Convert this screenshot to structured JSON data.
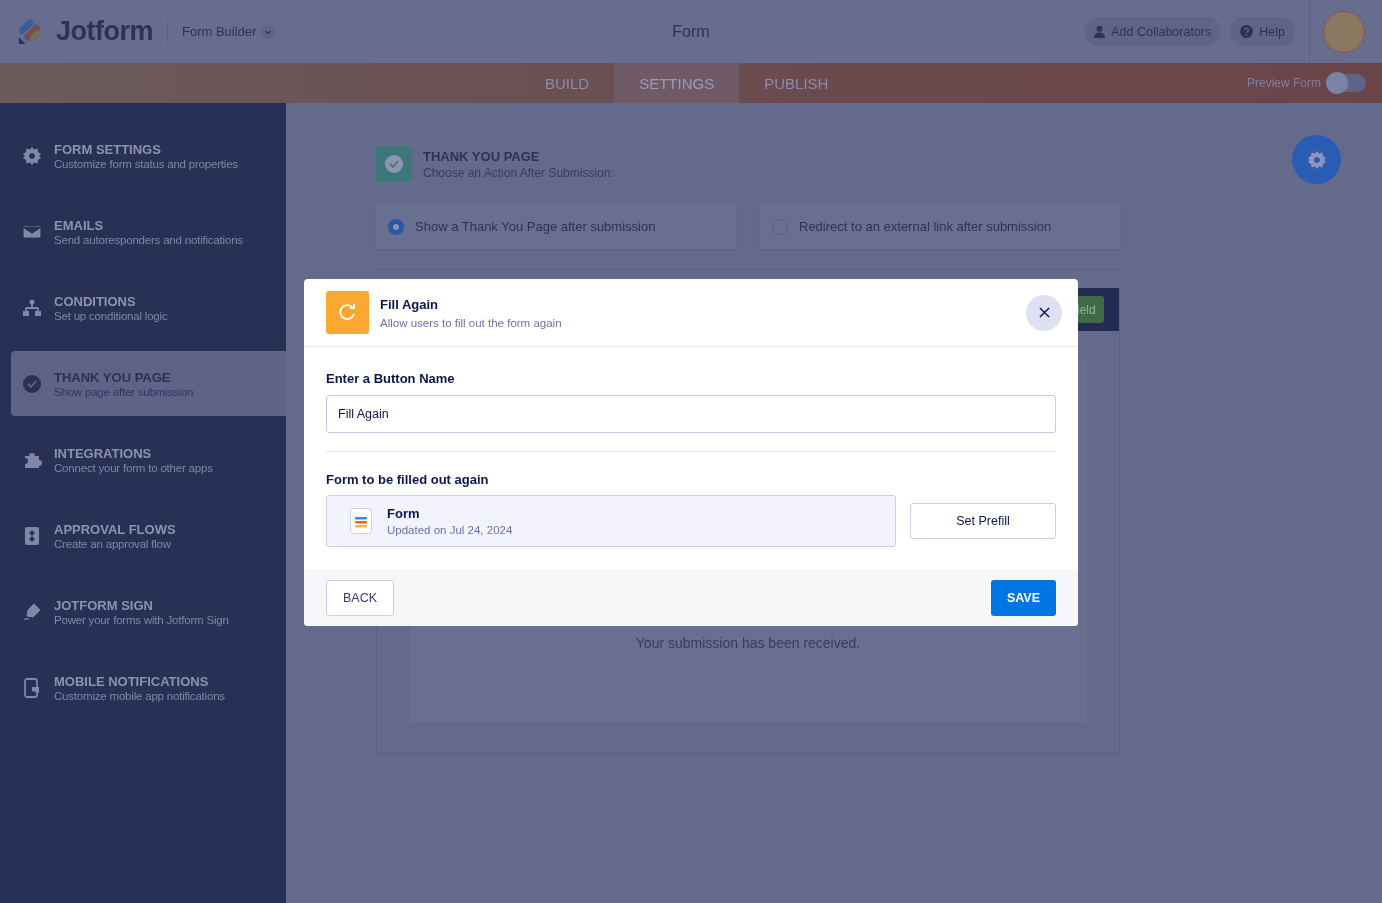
{
  "header": {
    "logo": "Jotform",
    "product": "Form Builder",
    "title": "Form",
    "buttons": [
      {
        "kind": "collaborators",
        "label": "Add Collaborators"
      },
      {
        "kind": "help",
        "label": "Help"
      }
    ]
  },
  "tabs": [
    {
      "label": "BUILD",
      "selected": false
    },
    {
      "label": "SETTINGS",
      "selected": true
    },
    {
      "label": "PUBLISH",
      "selected": false
    }
  ],
  "preview": {
    "label": "Preview Form",
    "on": false
  },
  "sidebar": {
    "items": [
      {
        "kind": "gear",
        "title": "FORM SETTINGS",
        "subtitle": "Customize form status and properties",
        "selected": false
      },
      {
        "kind": "mail",
        "title": "EMAILS",
        "subtitle": "Send autoresponders and notifications",
        "selected": false
      },
      {
        "kind": "tree",
        "title": "CONDITIONS",
        "subtitle": "Set up conditional logic",
        "selected": false
      },
      {
        "kind": "check",
        "title": "THANK YOU PAGE",
        "subtitle": "Show page after submission",
        "selected": true
      },
      {
        "kind": "puzzle",
        "title": "INTEGRATIONS",
        "subtitle": "Connect your form to other apps",
        "selected": false
      },
      {
        "kind": "flow",
        "title": "APPROVAL FLOWS",
        "subtitle": "Create an approval flow",
        "selected": false
      },
      {
        "kind": "pen",
        "title": "JOTFORM SIGN",
        "subtitle": "Power your forms with Jotform Sign",
        "selected": false
      },
      {
        "kind": "phone",
        "title": "MOBILE NOTIFICATIONS",
        "subtitle": "Customize mobile app notifications",
        "selected": false
      }
    ]
  },
  "thank_you": {
    "title": "THANK YOU PAGE",
    "subtitle": "Choose an Action After Submission:",
    "options": [
      {
        "label": "Show a Thank You Page after submission",
        "selected": true
      },
      {
        "label": "Redirect to an external link after submission",
        "selected": false
      }
    ],
    "toolbar_button": "ield",
    "preview_text": "Your submission has been received."
  },
  "modal": {
    "title": "Fill Again",
    "subtitle": "Allow users to fill out the form again",
    "button_name_label": "Enter a Button Name",
    "button_name_value": "Fill Again",
    "form_label": "Form to be filled out again",
    "form": {
      "name": "Form",
      "updated": "Updated on Jul 24, 2024"
    },
    "prefill_button": "Set Prefill",
    "back_button": "BACK",
    "save_button": "SAVE"
  }
}
